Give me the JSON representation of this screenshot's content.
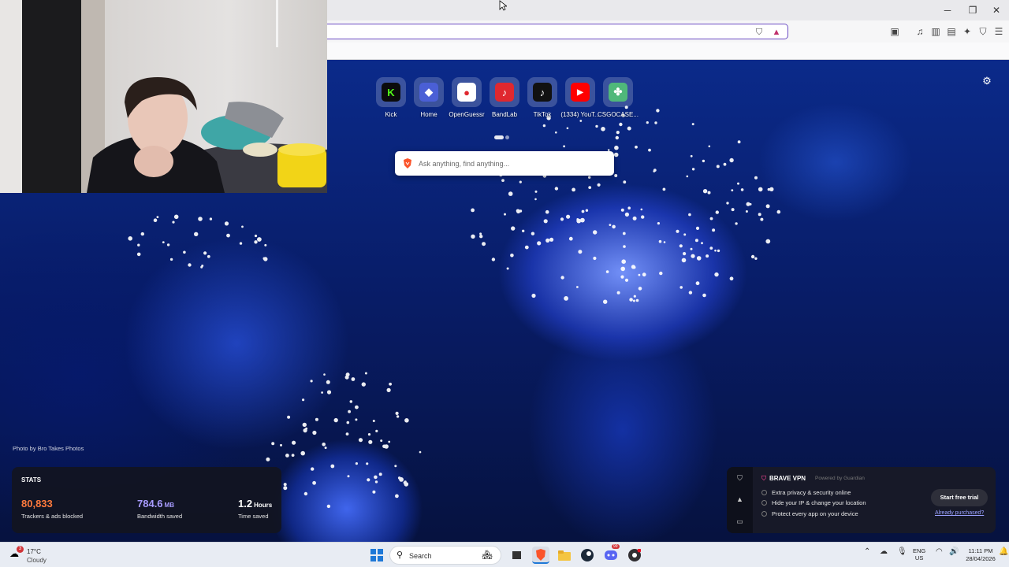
{
  "tiles": [
    {
      "label": "Kick",
      "icon": "kick-logo-icon",
      "bg": "#0b0b0b",
      "fg": "#53fc18",
      "glyph": "K"
    },
    {
      "label": "Home",
      "icon": "home-icon",
      "bg": "#4a5fd6",
      "fg": "#ffffff",
      "glyph": "◆"
    },
    {
      "label": "OpenGuessr",
      "icon": "openguessr-pin-icon",
      "bg": "#ffffff",
      "fg": "#e0282f",
      "glyph": "●"
    },
    {
      "label": "BandLab",
      "icon": "bandlab-logo-icon",
      "bg": "#e0282f",
      "fg": "#ffffff",
      "glyph": "♪"
    },
    {
      "label": "TikTok",
      "icon": "tiktok-logo-icon",
      "bg": "#111111",
      "fg": "#ffffff",
      "glyph": "♪"
    },
    {
      "label": "(1334) YouT...",
      "icon": "youtube-logo-icon",
      "bg": "#ff0000",
      "fg": "#ffffff",
      "glyph": "▶"
    },
    {
      "label": "CSGOCASE...",
      "icon": "csgocase-logo-icon",
      "bg": "#4fb87a",
      "fg": "#ffffff",
      "glyph": "✤"
    }
  ],
  "search": {
    "placeholder": "Ask anything, find anything..."
  },
  "photo_credit": "Photo by Bro Takes Photos",
  "stats": {
    "title": "STATS",
    "trackers": {
      "value": "80,833",
      "label": "Trackers & ads blocked",
      "color": "#ff7a3d"
    },
    "bandwidth": {
      "value": "784.6",
      "unit": "MB",
      "label": "Bandwidth saved",
      "color": "#a79bff"
    },
    "time": {
      "value": "1.2",
      "unit": "Hours",
      "label": "Time saved",
      "color": "#ffffff"
    }
  },
  "vpn": {
    "title": "BRAVE VPN",
    "powered": "Powered by Guardian",
    "features": [
      "Extra privacy & security online",
      "Hide your IP & change your location",
      "Protect every app on your device"
    ],
    "cta": "Start free trial",
    "link": "Already purchased?"
  },
  "taskbar": {
    "weather_badge": "3",
    "temperature": "17°C",
    "condition": "Cloudy",
    "search_placeholder": "Search",
    "lang_line1": "ENG",
    "lang_line2": "US",
    "time": "11:11 PM",
    "date": "28/04/2026",
    "discord_badge": "99"
  },
  "colors": {
    "accent": "#6a4bc4",
    "brave_orange": "#fb542b"
  }
}
